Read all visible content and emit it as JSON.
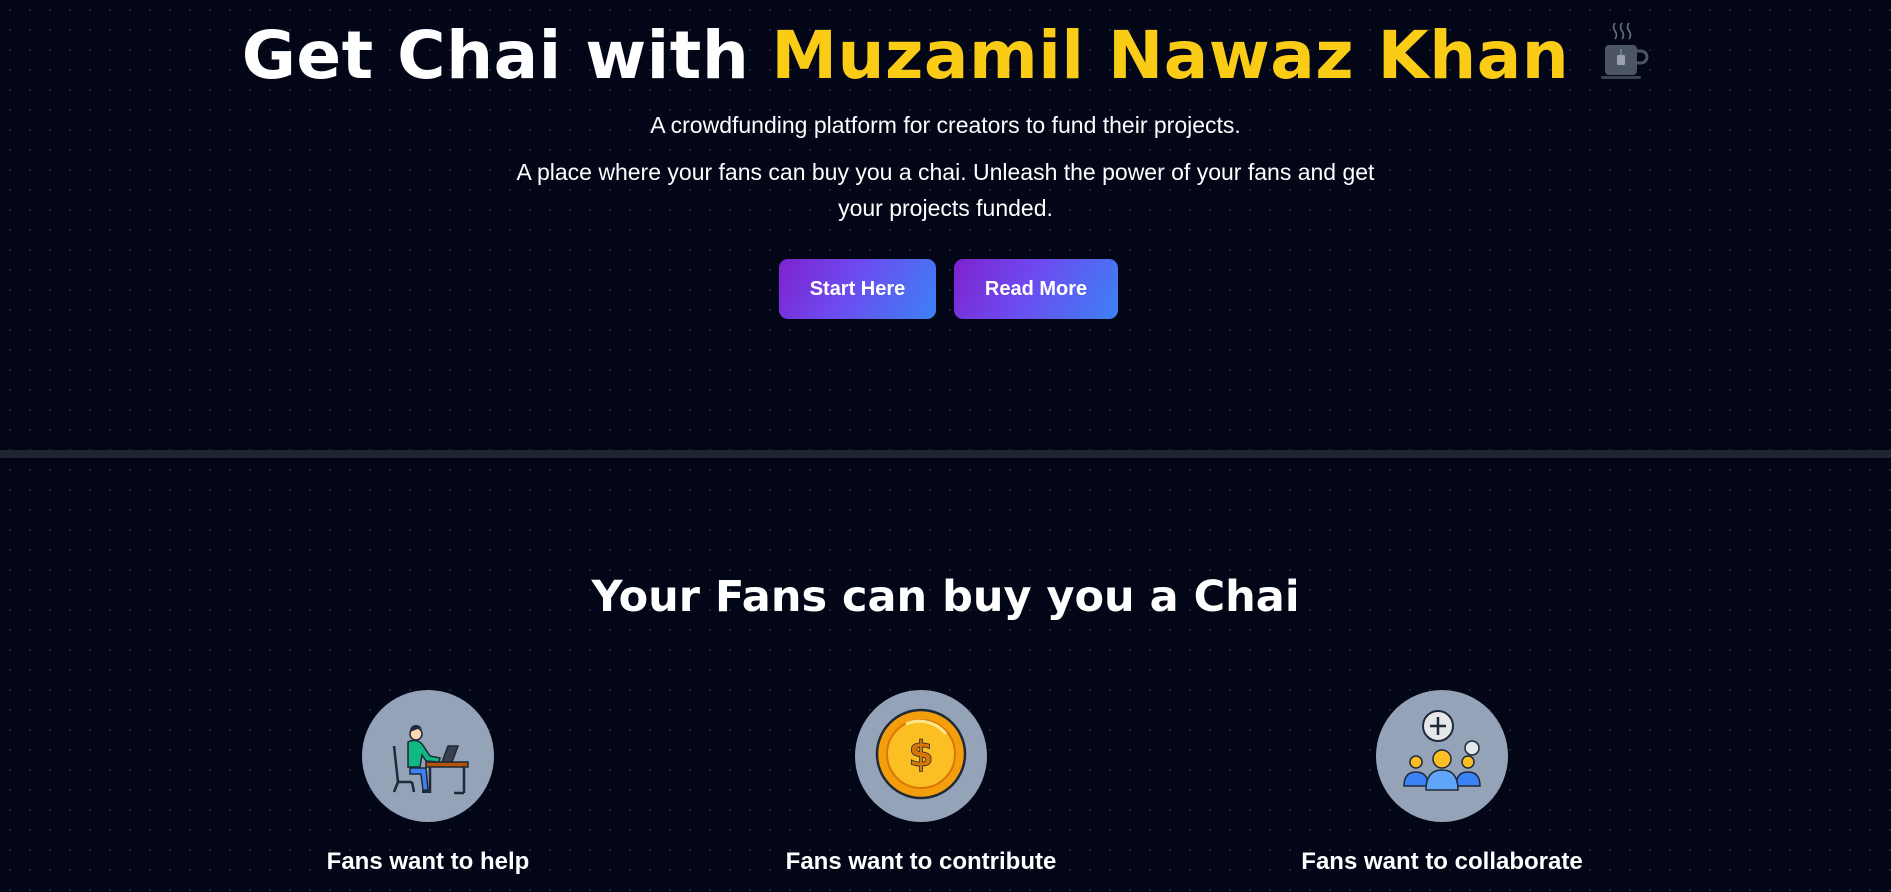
{
  "hero": {
    "title_prefix": "Get Chai with",
    "title_name": "Muzamil Nawaz Khan",
    "title_icon": "tea-cup-icon",
    "tagline": "A crowdfunding platform for creators to fund their projects.",
    "description": "A place where your fans can buy you a chai. Unleash the power of your fans and get your projects funded.",
    "buttons": {
      "start_label": "Start Here",
      "read_label": "Read More"
    }
  },
  "features": {
    "title": "Your Fans can buy you a Chai",
    "items": [
      {
        "label": "Fans want to help",
        "icon": "person-working-at-desk-icon"
      },
      {
        "label": "Fans want to contribute",
        "icon": "dollar-coin-icon"
      },
      {
        "label": "Fans want to collaborate",
        "icon": "group-collaboration-icon"
      }
    ]
  },
  "colors": {
    "background": "#020617",
    "accent_name": "#facc15",
    "button_gradient_start": "#7e22ce",
    "button_gradient_end": "#3b82f6",
    "icon_circle": "#94a3b8"
  }
}
